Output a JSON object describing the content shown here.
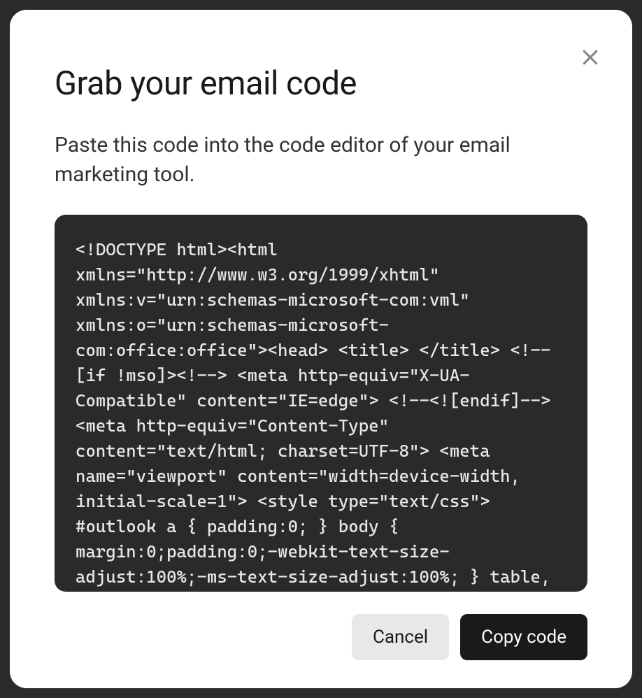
{
  "modal": {
    "title": "Grab your email code",
    "description": "Paste this code into the code editor of your email marketing tool.",
    "code": "<!DOCTYPE html><html xmlns=\"http://www.w3.org/1999/xhtml\" xmlns:v=\"urn:schemas-microsoft-com:vml\" xmlns:o=\"urn:schemas-microsoft-com:office:office\"><head> <title> </title> <!--[if !mso]><!--> <meta http-equiv=\"X-UA-Compatible\" content=\"IE=edge\"> <!--<![endif]--> <meta http-equiv=\"Content-Type\" content=\"text/html; charset=UTF-8\"> <meta name=\"viewport\" content=\"width=device-width, initial-scale=1\"> <style type=\"text/css\"> #outlook a { padding:0; } body { margin:0;padding:0;-webkit-text-size-adjust:100%;-ms-text-size-adjust:100%; } table,",
    "buttons": {
      "cancel": "Cancel",
      "copy": "Copy code"
    },
    "close_icon": "close-icon"
  }
}
